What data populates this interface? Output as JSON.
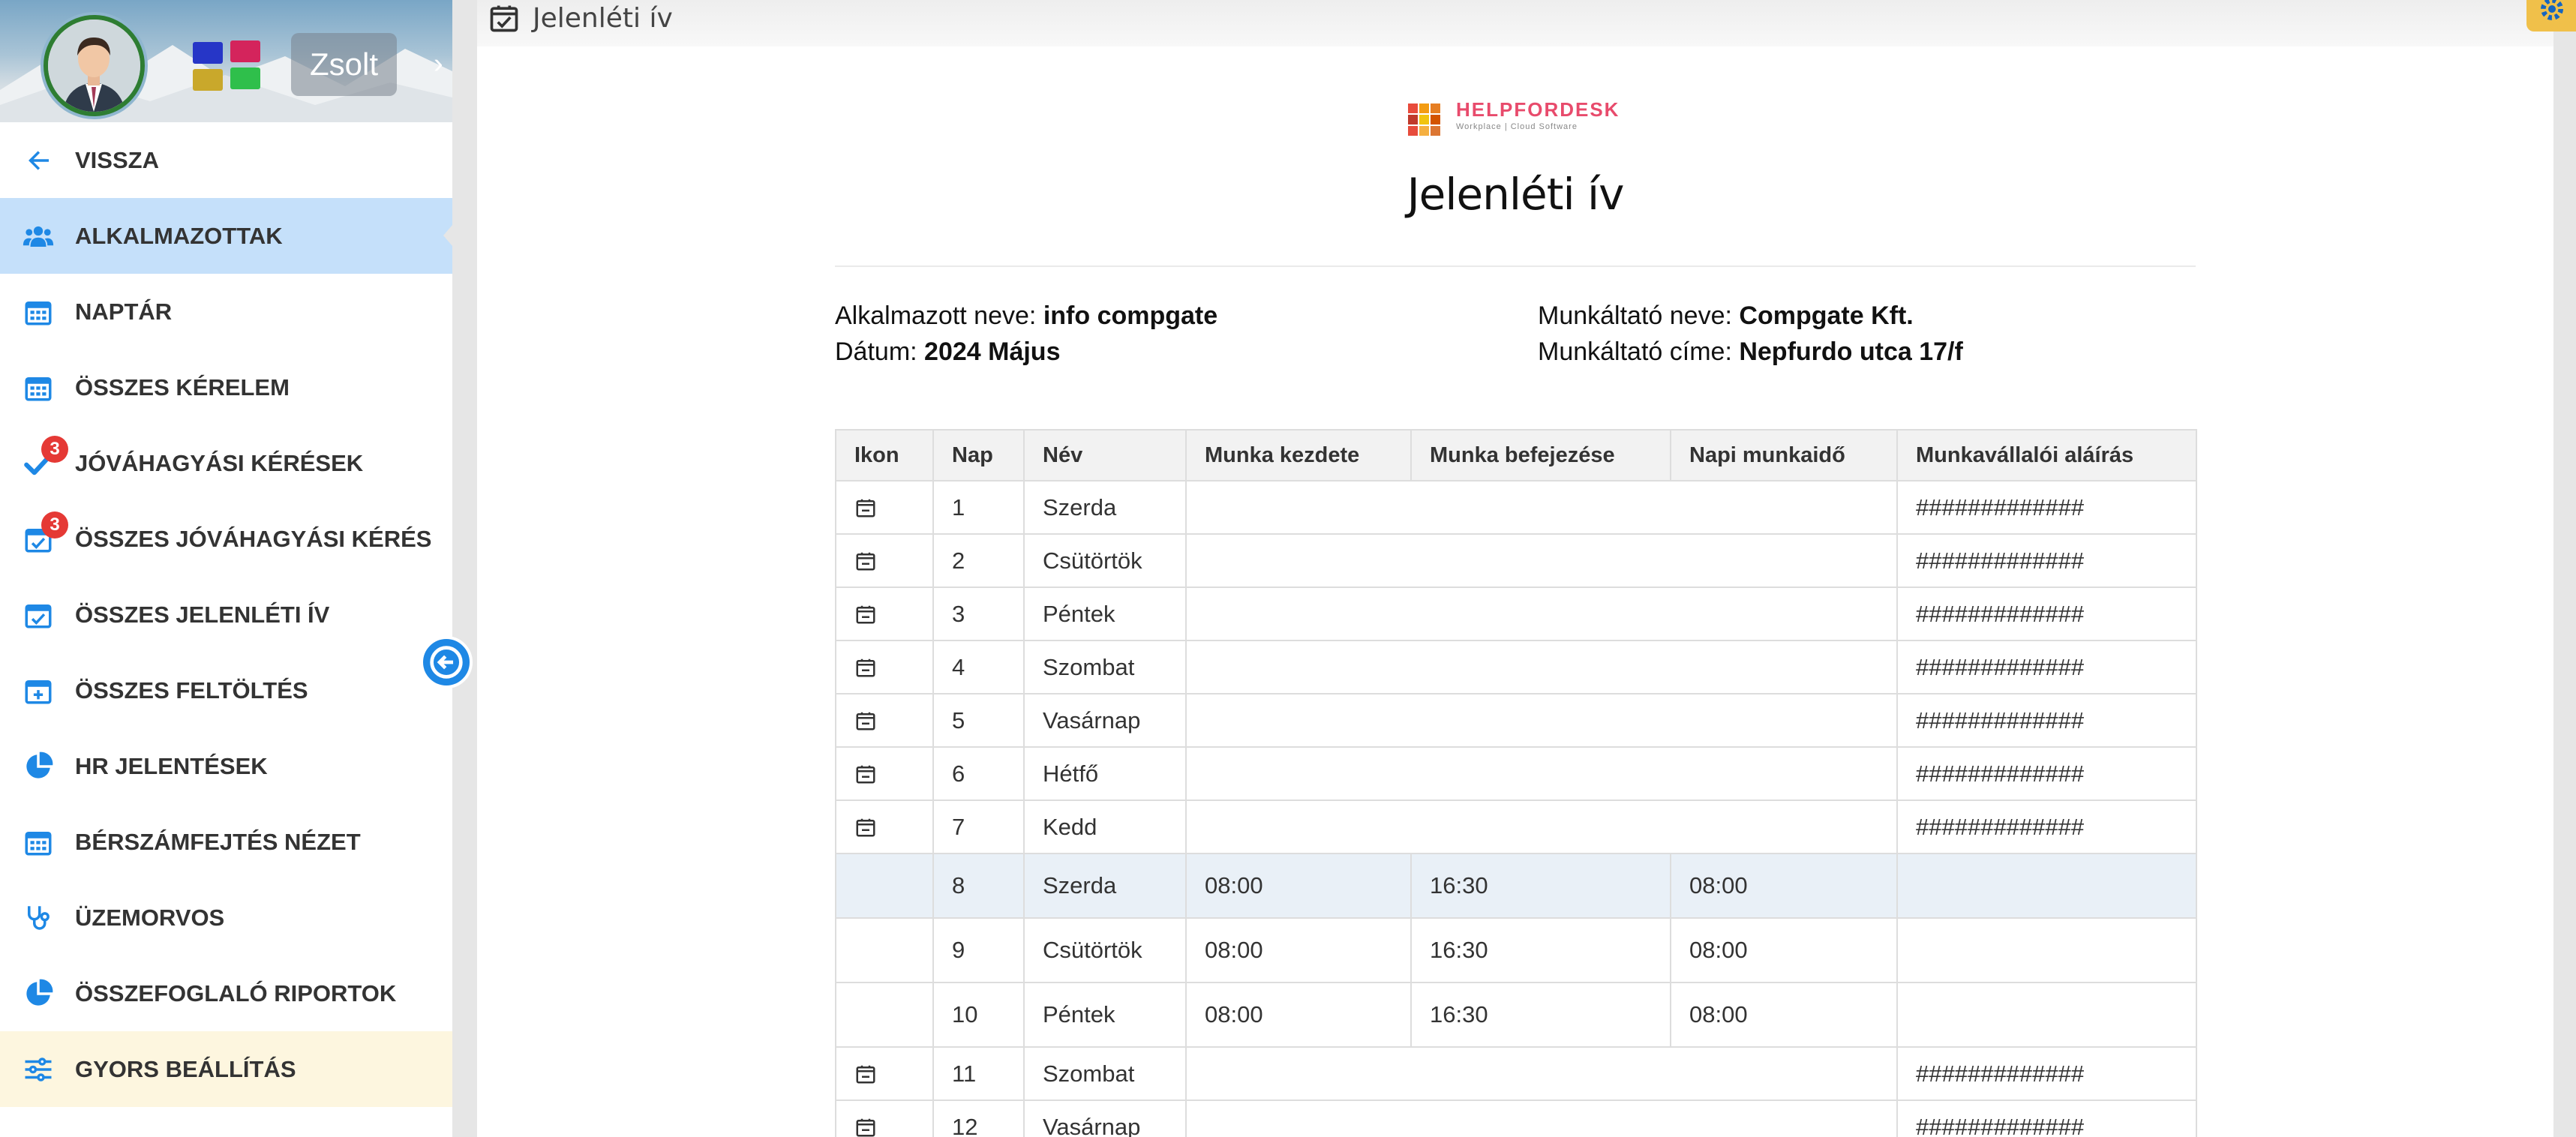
{
  "sidebar": {
    "user_name": "Zsolt",
    "items": [
      {
        "label": "VISSZA",
        "icon": "arrow-left-icon"
      },
      {
        "label": "ALKALMAZOTTAK",
        "icon": "users-icon"
      },
      {
        "label": "NAPTÁR",
        "icon": "calendar-icon"
      },
      {
        "label": "ÖSSZES KÉRELEM",
        "icon": "calendar-icon"
      },
      {
        "label": "JÓVÁHAGYÁSI KÉRÉSEK",
        "icon": "check-icon",
        "badge": "3"
      },
      {
        "label": "ÖSSZES JÓVÁHAGYÁSI KÉRÉS",
        "icon": "calendar-check-icon",
        "badge": "3"
      },
      {
        "label": "ÖSSZES JELENLÉTI ÍV",
        "icon": "calendar-check-icon"
      },
      {
        "label": "ÖSSZES FELTÖLTÉS",
        "icon": "calendar-plus-icon"
      },
      {
        "label": "HR JELENTÉSEK",
        "icon": "pie-chart-icon"
      },
      {
        "label": "BÉRSZÁMFEJTÉS NÉZET",
        "icon": "calendar-icon"
      },
      {
        "label": "ÜZEMORVOS",
        "icon": "stethoscope-icon"
      },
      {
        "label": "ÖSSZEFOGLALÓ RIPORTOK",
        "icon": "pie-chart-icon"
      },
      {
        "label": "GYORS BEÁLLÍTÁS",
        "icon": "sliders-icon"
      }
    ]
  },
  "topbar": {
    "title": "Jelenléti ív"
  },
  "logo": {
    "name": "HELPFORDESK",
    "tagline": "Workplace | Cloud Software"
  },
  "document": {
    "title": "Jelenléti ív",
    "employee_label": "Alkalmazott neve:",
    "employee_value": "info compgate",
    "date_label": "Dátum:",
    "date_value": "2024 Május",
    "employer_label": "Munkáltató neve:",
    "employer_value": "Compgate Kft.",
    "address_label": "Munkáltató címe:",
    "address_value": "Nepfurdo utca 17/f"
  },
  "table": {
    "headers": [
      "Ikon",
      "Nap",
      "Név",
      "Munka kezdete",
      "Munka befejezése",
      "Napi munkaidő",
      "Munkavállalói aláírás"
    ],
    "rows": [
      {
        "day": "1",
        "name": "Szerda",
        "signature": "#############"
      },
      {
        "day": "2",
        "name": "Csütörtök",
        "signature": "#############"
      },
      {
        "day": "3",
        "name": "Péntek",
        "signature": "#############"
      },
      {
        "day": "4",
        "name": "Szombat",
        "signature": "#############"
      },
      {
        "day": "5",
        "name": "Vasárnap",
        "signature": "#############"
      },
      {
        "day": "6",
        "name": "Hétfő",
        "signature": "#############"
      },
      {
        "day": "7",
        "name": "Kedd",
        "signature": "#############"
      },
      {
        "day": "8",
        "name": "Szerda",
        "start": "08:00",
        "end": "16:30",
        "hours": "08:00"
      },
      {
        "day": "9",
        "name": "Csütörtök",
        "start": "08:00",
        "end": "16:30",
        "hours": "08:00"
      },
      {
        "day": "10",
        "name": "Péntek",
        "start": "08:00",
        "end": "16:30",
        "hours": "08:00"
      },
      {
        "day": "11",
        "name": "Szombat",
        "signature": "#############"
      },
      {
        "day": "12",
        "name": "Vasárnap",
        "signature": "#############"
      }
    ]
  },
  "colors": {
    "accent": "#1e88e5",
    "active_bg": "#c5e0fa",
    "badge": "#e53935"
  }
}
